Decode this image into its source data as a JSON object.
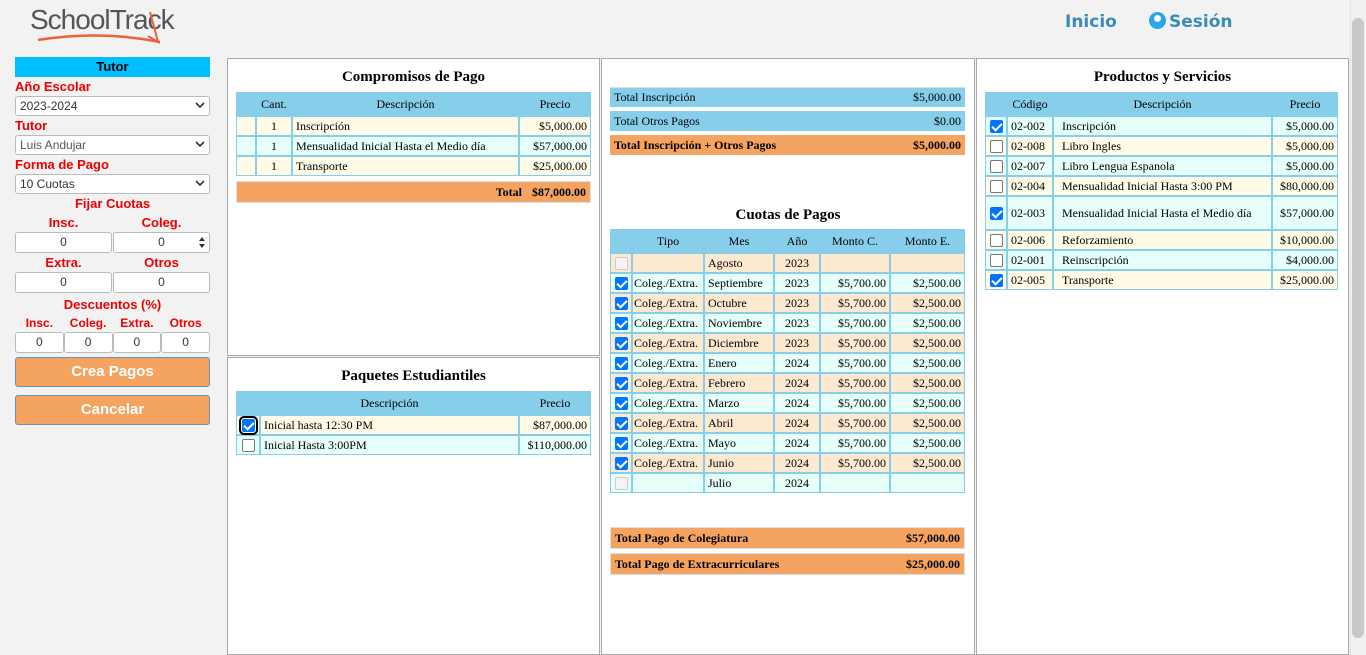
{
  "header": {
    "logo": "SchoolTrack",
    "nav_home": "Inicio",
    "nav_session": "Sesión"
  },
  "sidebar": {
    "section_title": "Tutor",
    "year_label": "Año Escolar",
    "year_value": "2023-2024",
    "tutor_label": "Tutor",
    "tutor_value": "Luis Andujar",
    "payment_label": "Forma de Pago",
    "payment_value": "10 Cuotas",
    "fix_title": "Fijar Cuotas",
    "insc_label": "Insc.",
    "coleg_label": "Coleg.",
    "insc_value": "0",
    "coleg_value": "0",
    "extra_label": "Extra.",
    "otros_label": "Otros",
    "extra_value": "0",
    "otros_value": "0",
    "disc_title": "Descuentos (%)",
    "disc_labels": [
      "Insc.",
      "Coleg.",
      "Extra.",
      "Otros"
    ],
    "disc_values": [
      "0",
      "0",
      "0",
      "0"
    ],
    "create_button": "Crea Pagos",
    "cancel_button": "Cancelar"
  },
  "commitments": {
    "title": "Compromisos de Pago",
    "headers": [
      "Cant.",
      "Descripción",
      "Precio"
    ],
    "rows": [
      {
        "qty": "1",
        "desc": "Inscripción",
        "price": "$5,000.00"
      },
      {
        "qty": "1",
        "desc": "Mensualidad Inicial Hasta el Medio día",
        "price": "$57,000.00"
      },
      {
        "qty": "1",
        "desc": "Transporte",
        "price": "$25,000.00"
      }
    ],
    "total_label": "Total",
    "total_value": "$87,000.00"
  },
  "packages": {
    "title": "Paquetes Estudiantiles",
    "headers": [
      "Descripción",
      "Precio"
    ],
    "rows": [
      {
        "checked": true,
        "desc": "Inicial hasta 12:30 PM",
        "price": "$87,000.00"
      },
      {
        "checked": false,
        "desc": "Inicial Hasta 3:00PM",
        "price": "$110,000.00"
      }
    ]
  },
  "summary": {
    "insc_label": "Total Inscripción",
    "insc_value": "$5,000.00",
    "other_label": "Total Otros Pagos",
    "other_value": "$0.00",
    "total_label": "Total Inscripción + Otros Pagos",
    "total_value": "$5,000.00"
  },
  "installments": {
    "title": "Cuotas de Pagos",
    "headers": [
      "Tipo",
      "Mes",
      "Año",
      "Monto C.",
      "Monto E."
    ],
    "rows": [
      {
        "checked": false,
        "disabled": true,
        "type": "",
        "month": "Agosto",
        "year": "2023",
        "c": "",
        "e": ""
      },
      {
        "checked": true,
        "type": "Coleg./Extra.",
        "month": "Septiembre",
        "year": "2023",
        "c": "$5,700.00",
        "e": "$2,500.00"
      },
      {
        "checked": true,
        "type": "Coleg./Extra.",
        "month": "Octubre",
        "year": "2023",
        "c": "$5,700.00",
        "e": "$2,500.00"
      },
      {
        "checked": true,
        "type": "Coleg./Extra.",
        "month": "Noviembre",
        "year": "2023",
        "c": "$5,700.00",
        "e": "$2,500.00"
      },
      {
        "checked": true,
        "type": "Coleg./Extra.",
        "month": "Diciembre",
        "year": "2023",
        "c": "$5,700.00",
        "e": "$2,500.00"
      },
      {
        "checked": true,
        "type": "Coleg./Extra.",
        "month": "Enero",
        "year": "2024",
        "c": "$5,700.00",
        "e": "$2,500.00"
      },
      {
        "checked": true,
        "type": "Coleg./Extra.",
        "month": "Febrero",
        "year": "2024",
        "c": "$5,700.00",
        "e": "$2,500.00"
      },
      {
        "checked": true,
        "type": "Coleg./Extra.",
        "month": "Marzo",
        "year": "2024",
        "c": "$5,700.00",
        "e": "$2,500.00"
      },
      {
        "checked": true,
        "type": "Coleg./Extra.",
        "month": "Abril",
        "year": "2024",
        "c": "$5,700.00",
        "e": "$2,500.00"
      },
      {
        "checked": true,
        "type": "Coleg./Extra.",
        "month": "Mayo",
        "year": "2024",
        "c": "$5,700.00",
        "e": "$2,500.00"
      },
      {
        "checked": true,
        "type": "Coleg./Extra.",
        "month": "Junio",
        "year": "2024",
        "c": "$5,700.00",
        "e": "$2,500.00"
      },
      {
        "checked": false,
        "disabled": true,
        "type": "",
        "month": "Julio",
        "year": "2024",
        "c": "",
        "e": ""
      }
    ],
    "total_coleg_label": "Total Pago de Colegiatura",
    "total_coleg_value": "$57,000.00",
    "total_extra_label": "Total Pago de Extracurriculares",
    "total_extra_value": "$25,000.00"
  },
  "products": {
    "title": "Productos y Servicios",
    "headers": [
      "Código",
      "Descripción",
      "Precio"
    ],
    "rows": [
      {
        "checked": true,
        "code": "02-002",
        "desc": "Inscripción",
        "price": "$5,000.00"
      },
      {
        "checked": false,
        "code": "02-008",
        "desc": "Libro Ingles",
        "price": "$5,000.00"
      },
      {
        "checked": false,
        "code": "02-007",
        "desc": "Libro Lengua Espanola",
        "price": "$5,000.00"
      },
      {
        "checked": false,
        "code": "02-004",
        "desc": "Mensualidad Inicial Hasta 3:00 PM",
        "price": "$80,000.00"
      },
      {
        "checked": true,
        "code": "02-003",
        "desc": "Mensualidad Inicial Hasta el Medio día",
        "price": "$57,000.00"
      },
      {
        "checked": false,
        "code": "02-006",
        "desc": "Reforzamiento",
        "price": "$10,000.00"
      },
      {
        "checked": false,
        "code": "02-001",
        "desc": "Reinscripción",
        "price": "$4,000.00"
      },
      {
        "checked": true,
        "code": "02-005",
        "desc": "Transporte",
        "price": "$25,000.00"
      }
    ]
  }
}
